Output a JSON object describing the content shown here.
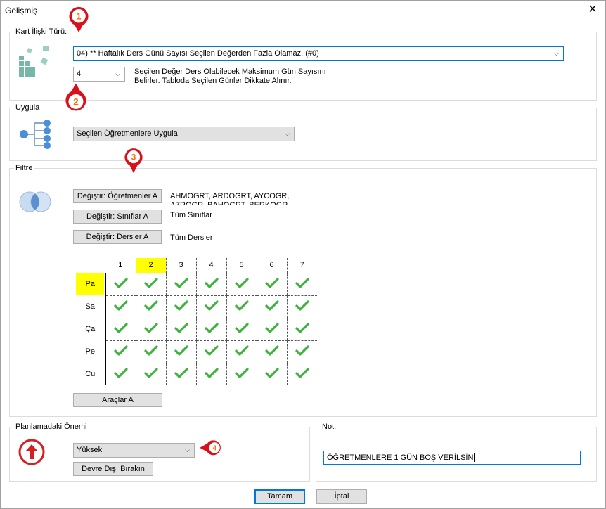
{
  "window": {
    "title": "Gelişmiş",
    "close_label": "✕"
  },
  "kart": {
    "legend": "Kart İlişki Türü:",
    "combo_value": "04) ** Haftalık Ders Günü Sayısı Seçilen Değerden Fazla Olamaz. (#0)",
    "number_value": "4",
    "desc_line1": "Seçilen Değer Ders Olabilecek Maksimum Gün Sayısını",
    "desc_line2": "Belirler. Tabloda Seçilen Günler Dikkate Alınır."
  },
  "uygula": {
    "legend": "Uygula",
    "combo_value": "Seçilen Öğretmenlere Uygula"
  },
  "filtre": {
    "legend": "Filtre",
    "btn_ogretmen": "Değiştir: Öğretmenler A",
    "btn_sinif": "Değiştir: Sınıflar A",
    "btn_ders": "Değiştir: Dersler A",
    "ogretmen_text1": "AHMOGRT, ARDOGRT, AYCOGR,",
    "ogretmen_text2": "AZROGR, BAHOGRT, BERKOGR,",
    "sinif_text": "Tüm Sınıflar",
    "ders_text": "Tüm Dersler",
    "btn_araclar": "Araçlar A",
    "columns": [
      "1",
      "2",
      "3",
      "4",
      "5",
      "6",
      "7"
    ],
    "rows": [
      "Pa",
      "Sa",
      "Ça",
      "Pe",
      "Cu"
    ],
    "highlight_col": "2",
    "highlight_row": "Pa",
    "check_color": "#3cb43c"
  },
  "onem": {
    "legend": "Planlamadaki Önemi",
    "combo_value": "Yüksek",
    "btn_devre": "Devre Dışı Bırakın"
  },
  "not": {
    "legend": "Not:",
    "value": "ÖĞRETMENLERE 1 GÜN BOŞ VERİLSİN"
  },
  "footer": {
    "ok": "Tamam",
    "cancel": "İptal"
  },
  "markers": [
    "1",
    "2",
    "3",
    "4"
  ],
  "colors": {
    "marker_red": "#d9101a",
    "marker_num": "#ff6a00",
    "icon_teal": "#76b7a8",
    "icon_blue": "#4a90d9",
    "arrow_red": "#d42020"
  }
}
